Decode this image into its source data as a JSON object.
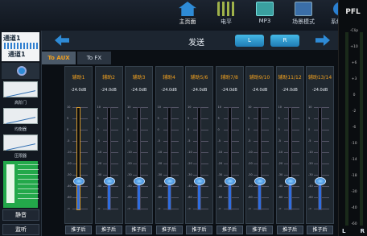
{
  "topnav": [
    {
      "label": "主页面",
      "icon": "home-icon",
      "active": true
    },
    {
      "label": "电平",
      "icon": "meter-icon",
      "active": false
    },
    {
      "label": "MP3",
      "icon": "mp3-icon",
      "active": false
    },
    {
      "label": "场景模式",
      "icon": "scene-icon",
      "active": false
    },
    {
      "label": "系统设置",
      "icon": "gear-icon",
      "active": false
    }
  ],
  "pfl": {
    "title": "PFL",
    "scale": [
      "-Clip",
      "+10",
      "+6",
      "+3",
      "0",
      "-2",
      "-6",
      "-10",
      "-14",
      "-18",
      "-30",
      "-40",
      "-60"
    ],
    "left": "L",
    "right": "R"
  },
  "left_panel": {
    "channel_title": "通道1",
    "channel_sub": "通道1",
    "eq_label": "高阶门",
    "comp_label": "均衡器",
    "gate_label": "压限器",
    "mute_label": "静音",
    "solo_label": "监听"
  },
  "header": {
    "title": "发送",
    "btn_l": "L",
    "btn_r": "R"
  },
  "tabs": [
    {
      "label": "To AUX",
      "active": true
    },
    {
      "label": "To FX",
      "active": false
    }
  ],
  "channels": [
    {
      "name": "辅助1",
      "db": "-24.0dB",
      "level": 0.28,
      "highlight": true
    },
    {
      "name": "辅助2",
      "db": "-24.0dB",
      "level": 0.28,
      "highlight": false
    },
    {
      "name": "辅助3",
      "db": "-24.0dB",
      "level": 0.28,
      "highlight": false
    },
    {
      "name": "辅助4",
      "db": "-24.0dB",
      "level": 0.28,
      "highlight": false
    },
    {
      "name": "辅助5/6",
      "db": "-24.0dB",
      "level": 0.28,
      "highlight": false
    },
    {
      "name": "辅助7/8",
      "db": "-24.0dB",
      "level": 0.28,
      "highlight": false
    },
    {
      "name": "辅助9/10",
      "db": "-24.0dB",
      "level": 0.28,
      "highlight": false
    },
    {
      "name": "辅助11/12",
      "db": "-24.0dB",
      "level": 0.28,
      "highlight": false
    },
    {
      "name": "辅助13/14",
      "db": "-24.0dB",
      "level": 0.28,
      "highlight": false
    }
  ],
  "fader_scale": [
    "10",
    "5",
    "0",
    "-5",
    "-10",
    "-20",
    "-30",
    "-40",
    "-60",
    "-∞"
  ],
  "post_label": "推子后"
}
